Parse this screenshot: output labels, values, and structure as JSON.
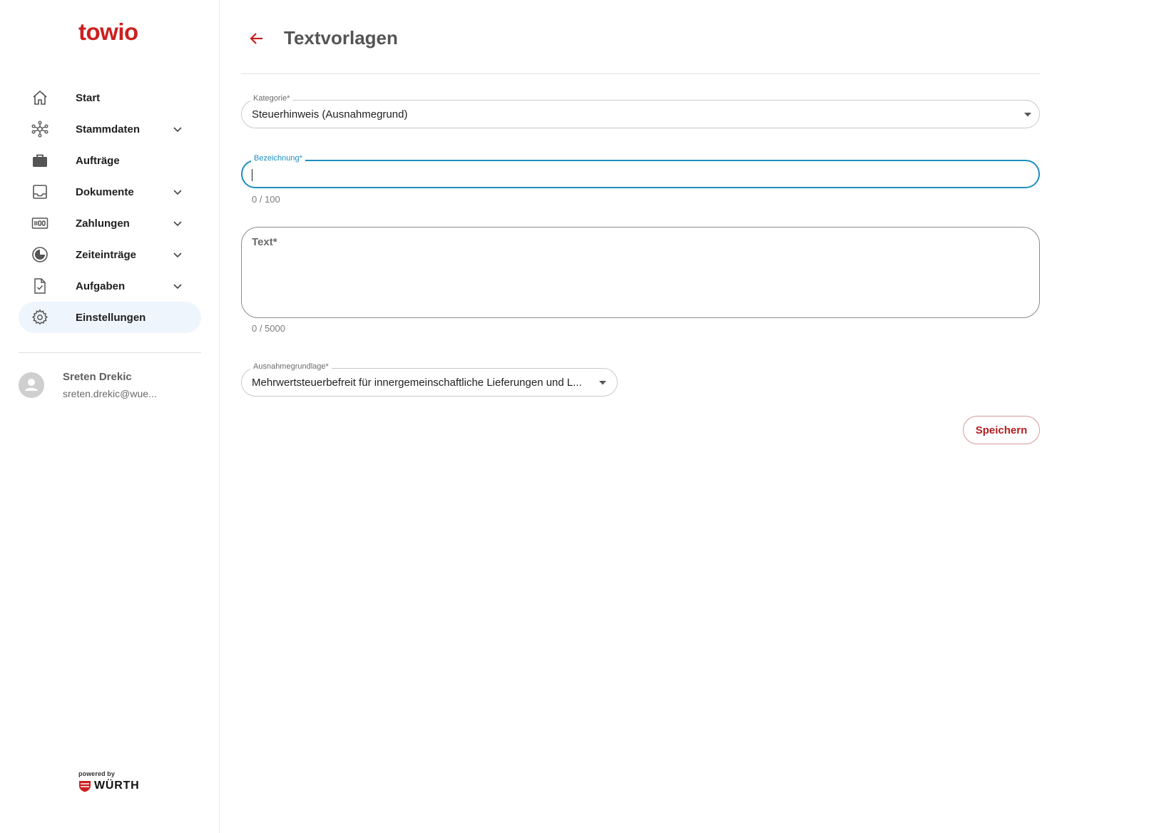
{
  "brand": {
    "logo": "towio",
    "accent": "#cc1f1f",
    "powered_by": "powered by",
    "partner": "WÜRTH"
  },
  "sidebar": {
    "items": [
      {
        "label": "Start",
        "icon": "home-icon",
        "has_chevron": false
      },
      {
        "label": "Stammdaten",
        "icon": "network-icon",
        "has_chevron": true
      },
      {
        "label": "Aufträge",
        "icon": "briefcase-icon",
        "has_chevron": false
      },
      {
        "label": "Dokumente",
        "icon": "inbox-icon",
        "has_chevron": true
      },
      {
        "label": "Zahlungen",
        "icon": "money-icon",
        "has_chevron": true
      },
      {
        "label": "Zeiteinträge",
        "icon": "clock-icon",
        "has_chevron": true
      },
      {
        "label": "Aufgaben",
        "icon": "task-file-icon",
        "has_chevron": true
      },
      {
        "label": "Einstellungen",
        "icon": "gear-icon",
        "has_chevron": false,
        "active": true
      }
    ]
  },
  "user": {
    "name": "Sreten Drekic",
    "email": "sreten.drekic@wue..."
  },
  "page": {
    "title": "Textvorlagen"
  },
  "form": {
    "kategorie": {
      "label": "Kategorie*",
      "value": "Steuerhinweis (Ausnahmegrund)"
    },
    "bezeichnung": {
      "label": "Bezeichnung*",
      "value": "",
      "counter": "0 / 100"
    },
    "text": {
      "placeholder": "Text*",
      "counter": "0 / 5000"
    },
    "ausnahmegrundlage": {
      "label": "Ausnahmegrundlage*",
      "value": "Mehrwertsteuerbefreit für innergemeinschaftliche Lieferungen und L..."
    },
    "save_label": "Speichern"
  },
  "colors": {
    "focus": "#1e8fbf",
    "active_nav_bg": "#eef5fc",
    "save_text": "#b31d1d"
  }
}
